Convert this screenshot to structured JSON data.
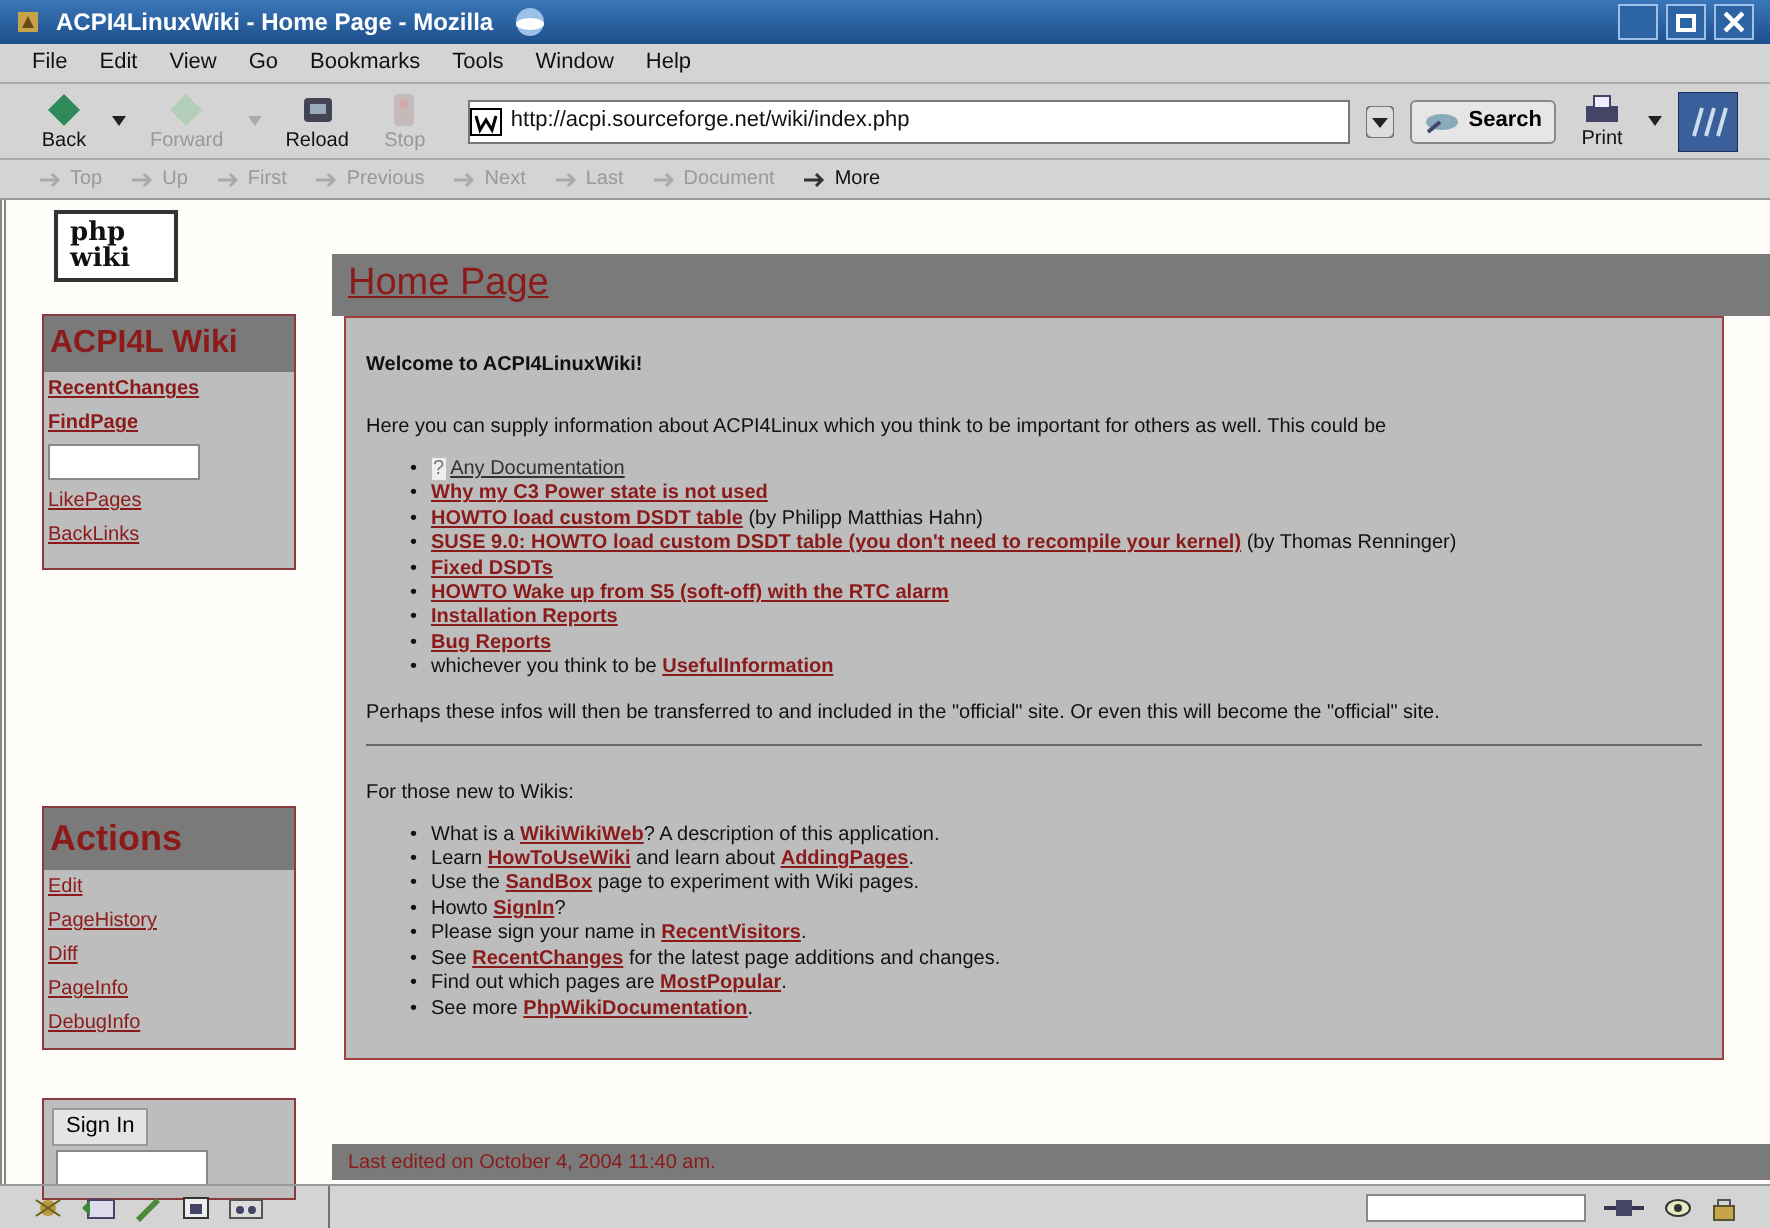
{
  "window": {
    "title": "ACPI4LinuxWiki - Home Page - Mozilla"
  },
  "menu": [
    "File",
    "Edit",
    "View",
    "Go",
    "Bookmarks",
    "Tools",
    "Window",
    "Help"
  ],
  "toolbar": [
    {
      "label": "Back",
      "disabled": false,
      "kind": "back"
    },
    {
      "label": "Forward",
      "disabled": true,
      "kind": "forward"
    },
    {
      "label": "Reload",
      "disabled": false,
      "kind": "reload"
    },
    {
      "label": "Stop",
      "disabled": true,
      "kind": "stop"
    }
  ],
  "address": {
    "value": "http://acpi.sourceforge.net/wiki/index.php"
  },
  "search_button": "Search",
  "print_button": "Print",
  "site_nav": [
    {
      "label": "Top",
      "disabled": true
    },
    {
      "label": "Up",
      "disabled": true
    },
    {
      "label": "First",
      "disabled": true
    },
    {
      "label": "Previous",
      "disabled": true
    },
    {
      "label": "Next",
      "disabled": true
    },
    {
      "label": "Last",
      "disabled": true
    },
    {
      "label": "Document",
      "disabled": true
    },
    {
      "label": "More",
      "disabled": false
    }
  ],
  "logo": [
    "php",
    "wiki"
  ],
  "sidebar": {
    "title": "ACPI4L Wiki",
    "links": [
      {
        "label": "RecentChanges",
        "bold": true
      },
      {
        "label": "FindPage",
        "bold": true
      }
    ],
    "links2": [
      "LikePages",
      "BackLinks"
    ]
  },
  "actions": {
    "title": "Actions",
    "links": [
      "Edit",
      "PageHistory",
      "Diff",
      "PageInfo",
      "DebugInfo"
    ]
  },
  "signin": {
    "button": "Sign In"
  },
  "page": {
    "title": "Home Page",
    "welcome": "Welcome to ACPI4LinuxWiki!",
    "intro": "Here you can supply information about ACPI4Linux which you think to be important for others as well. This could be",
    "bullet": "•",
    "list1": [
      [
        {
          "kind": "missing",
          "text": "?"
        },
        {
          "kind": "plain-link",
          "text": "Any Documentation"
        }
      ],
      [
        {
          "kind": "link",
          "text": "Why my C3 Power state is not used"
        }
      ],
      [
        {
          "kind": "link",
          "text": "HOWTO load custom DSDT table"
        },
        {
          "kind": "text",
          "text": " (by Philipp Matthias Hahn)"
        }
      ],
      [
        {
          "kind": "link",
          "text": "SUSE 9.0: HOWTO load custom DSDT table (you don't need to recompile your kernel)"
        },
        {
          "kind": "text",
          "text": " (by Thomas Renninger)"
        }
      ],
      [
        {
          "kind": "link",
          "text": "Fixed DSDTs"
        }
      ],
      [
        {
          "kind": "link",
          "text": "HOWTO Wake up from S5 (soft-off) with the RTC alarm"
        }
      ],
      [
        {
          "kind": "link",
          "text": "Installation Reports"
        }
      ],
      [
        {
          "kind": "link",
          "text": "Bug Reports"
        }
      ],
      [
        {
          "kind": "text",
          "text": "whichever you think to be "
        },
        {
          "kind": "link",
          "text": "UsefulInformation"
        }
      ]
    ],
    "outro": "Perhaps these infos will then be transferred to and included in the \"official\" site. Or even this will become the \"official\" site.",
    "new_heading": "For those new to Wikis:",
    "list2": [
      [
        {
          "kind": "text",
          "text": "What is a "
        },
        {
          "kind": "link",
          "text": "WikiWikiWeb"
        },
        {
          "kind": "text",
          "text": "? A description of this application."
        }
      ],
      [
        {
          "kind": "text",
          "text": "Learn "
        },
        {
          "kind": "link",
          "text": "HowToUseWiki"
        },
        {
          "kind": "text",
          "text": " and learn about "
        },
        {
          "kind": "link",
          "text": "AddingPages"
        },
        {
          "kind": "text",
          "text": "."
        }
      ],
      [
        {
          "kind": "text",
          "text": "Use the "
        },
        {
          "kind": "link",
          "text": "SandBox"
        },
        {
          "kind": "text",
          "text": " page to experiment with Wiki pages."
        }
      ],
      [
        {
          "kind": "text",
          "text": "Howto "
        },
        {
          "kind": "link",
          "text": "SignIn"
        },
        {
          "kind": "text",
          "text": "?"
        }
      ],
      [
        {
          "kind": "text",
          "text": "Please sign your name in "
        },
        {
          "kind": "link",
          "text": "RecentVisitors"
        },
        {
          "kind": "text",
          "text": "."
        }
      ],
      [
        {
          "kind": "text",
          "text": "See "
        },
        {
          "kind": "link",
          "text": "RecentChanges"
        },
        {
          "kind": "text",
          "text": " for the latest page additions and changes."
        }
      ],
      [
        {
          "kind": "text",
          "text": "Find out which pages are "
        },
        {
          "kind": "link",
          "text": "MostPopular"
        },
        {
          "kind": "text",
          "text": "."
        }
      ],
      [
        {
          "kind": "text",
          "text": "See more "
        },
        {
          "kind": "link",
          "text": "PhpWikiDocumentation"
        },
        {
          "kind": "text",
          "text": "."
        }
      ]
    ],
    "footer": "Last edited on October 4, 2004 11:40 am."
  }
}
